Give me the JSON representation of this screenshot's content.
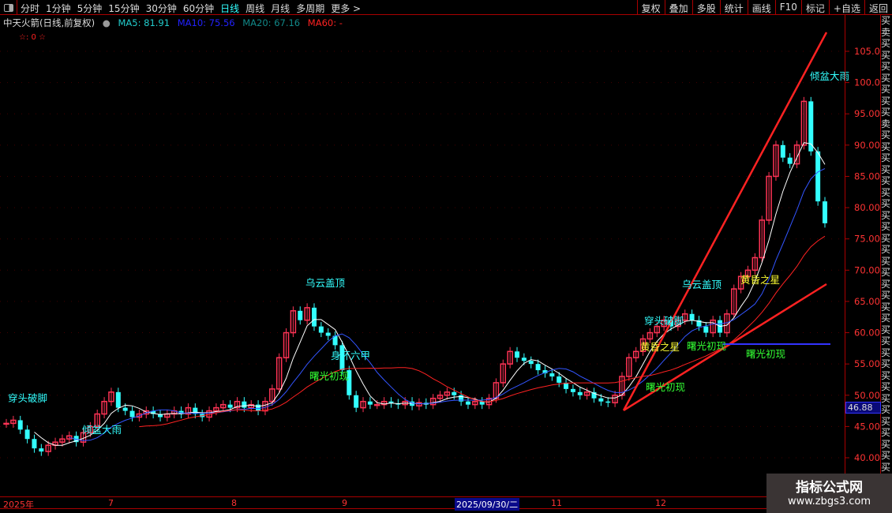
{
  "toolbar": {
    "periods": [
      "分时",
      "1分钟",
      "5分钟",
      "15分钟",
      "30分钟",
      "60分钟",
      "日线",
      "周线",
      "月线",
      "多周期",
      "更多 >"
    ],
    "active": "日线",
    "right_buttons": [
      "复权",
      "叠加",
      "多股",
      "统计",
      "画线",
      "F10",
      "标记",
      "+自选",
      "返回"
    ]
  },
  "legend": {
    "title": "中天火箭(日线,前复权)",
    "ma5": "MA5: 81.91",
    "ma10": "MA10: 75.56",
    "ma20": "MA20: 67.16",
    "ma60": "MA60: -",
    "stars": "☆: 0 ☆"
  },
  "colors": {
    "up": "#ff3355",
    "down": "#33ffff",
    "ma5": "#ffffff",
    "ma10": "#3355ff",
    "ma20": "#ff2222",
    "axis": "#aa0000"
  },
  "axis": {
    "price_labels": [
      "105.0",
      "100.0",
      "95.00",
      "90.00",
      "85.00",
      "80.00",
      "75.00",
      "70.00",
      "65.00",
      "60.00",
      "55.00",
      "50.00",
      "45.00",
      "40.00"
    ],
    "current_price": "46.88",
    "dates": [
      "2025年",
      "7",
      "8",
      "9",
      "2025/09/30/二",
      "11",
      "12"
    ]
  },
  "annotations": [
    "穿头破脚",
    "乌云盖顶",
    "倾盆大雨",
    "乌云盖顶",
    "身怀六甲",
    "曙光初现",
    "穿头破脚",
    "黄昏之星",
    "曙光初现",
    "曙光初现",
    "乌云盖顶",
    "黄昏之星",
    "曙光初现",
    "倾盆大雨"
  ],
  "side_text": "买卖买买买买买买买卖买买买买买买买买买买买买买买买买买买买买买买买买买买买买买买买买",
  "watermark": {
    "line1": "指标公式网",
    "line2": "www.zbgs3.com"
  },
  "chart_data": {
    "type": "candlestick",
    "ylim": [
      37,
      108
    ],
    "close": [
      45.5,
      46,
      44.5,
      43,
      41.5,
      41,
      42,
      42.5,
      43,
      43.5,
      42.5,
      44,
      45,
      47,
      49,
      50.5,
      48,
      47.5,
      46.5,
      47,
      47.5,
      47,
      46.5,
      47,
      47.5,
      47,
      48,
      47,
      46.5,
      47.5,
      48,
      48.5,
      48,
      49,
      48,
      48.5,
      47.5,
      49,
      51,
      56,
      60,
      63.5,
      62,
      64,
      61,
      60,
      59.5,
      58,
      54,
      50,
      48,
      49,
      48.5,
      48.5,
      49,
      48.7,
      48.5,
      49,
      48.3,
      48.8,
      48.5,
      49.5,
      50,
      50.5,
      50,
      49,
      48.5,
      49,
      48.5,
      49.5,
      52,
      55,
      57,
      56,
      55.5,
      55,
      54,
      53.5,
      53,
      52,
      51,
      50.5,
      50,
      50.5,
      49.5,
      49,
      48.8,
      50,
      53,
      56,
      57,
      59,
      60,
      61,
      62,
      61,
      62,
      63,
      62,
      61,
      60,
      62,
      60,
      63,
      67,
      69,
      70,
      72,
      78,
      85,
      90,
      88,
      87,
      90,
      97,
      89,
      81,
      77.5
    ]
  }
}
